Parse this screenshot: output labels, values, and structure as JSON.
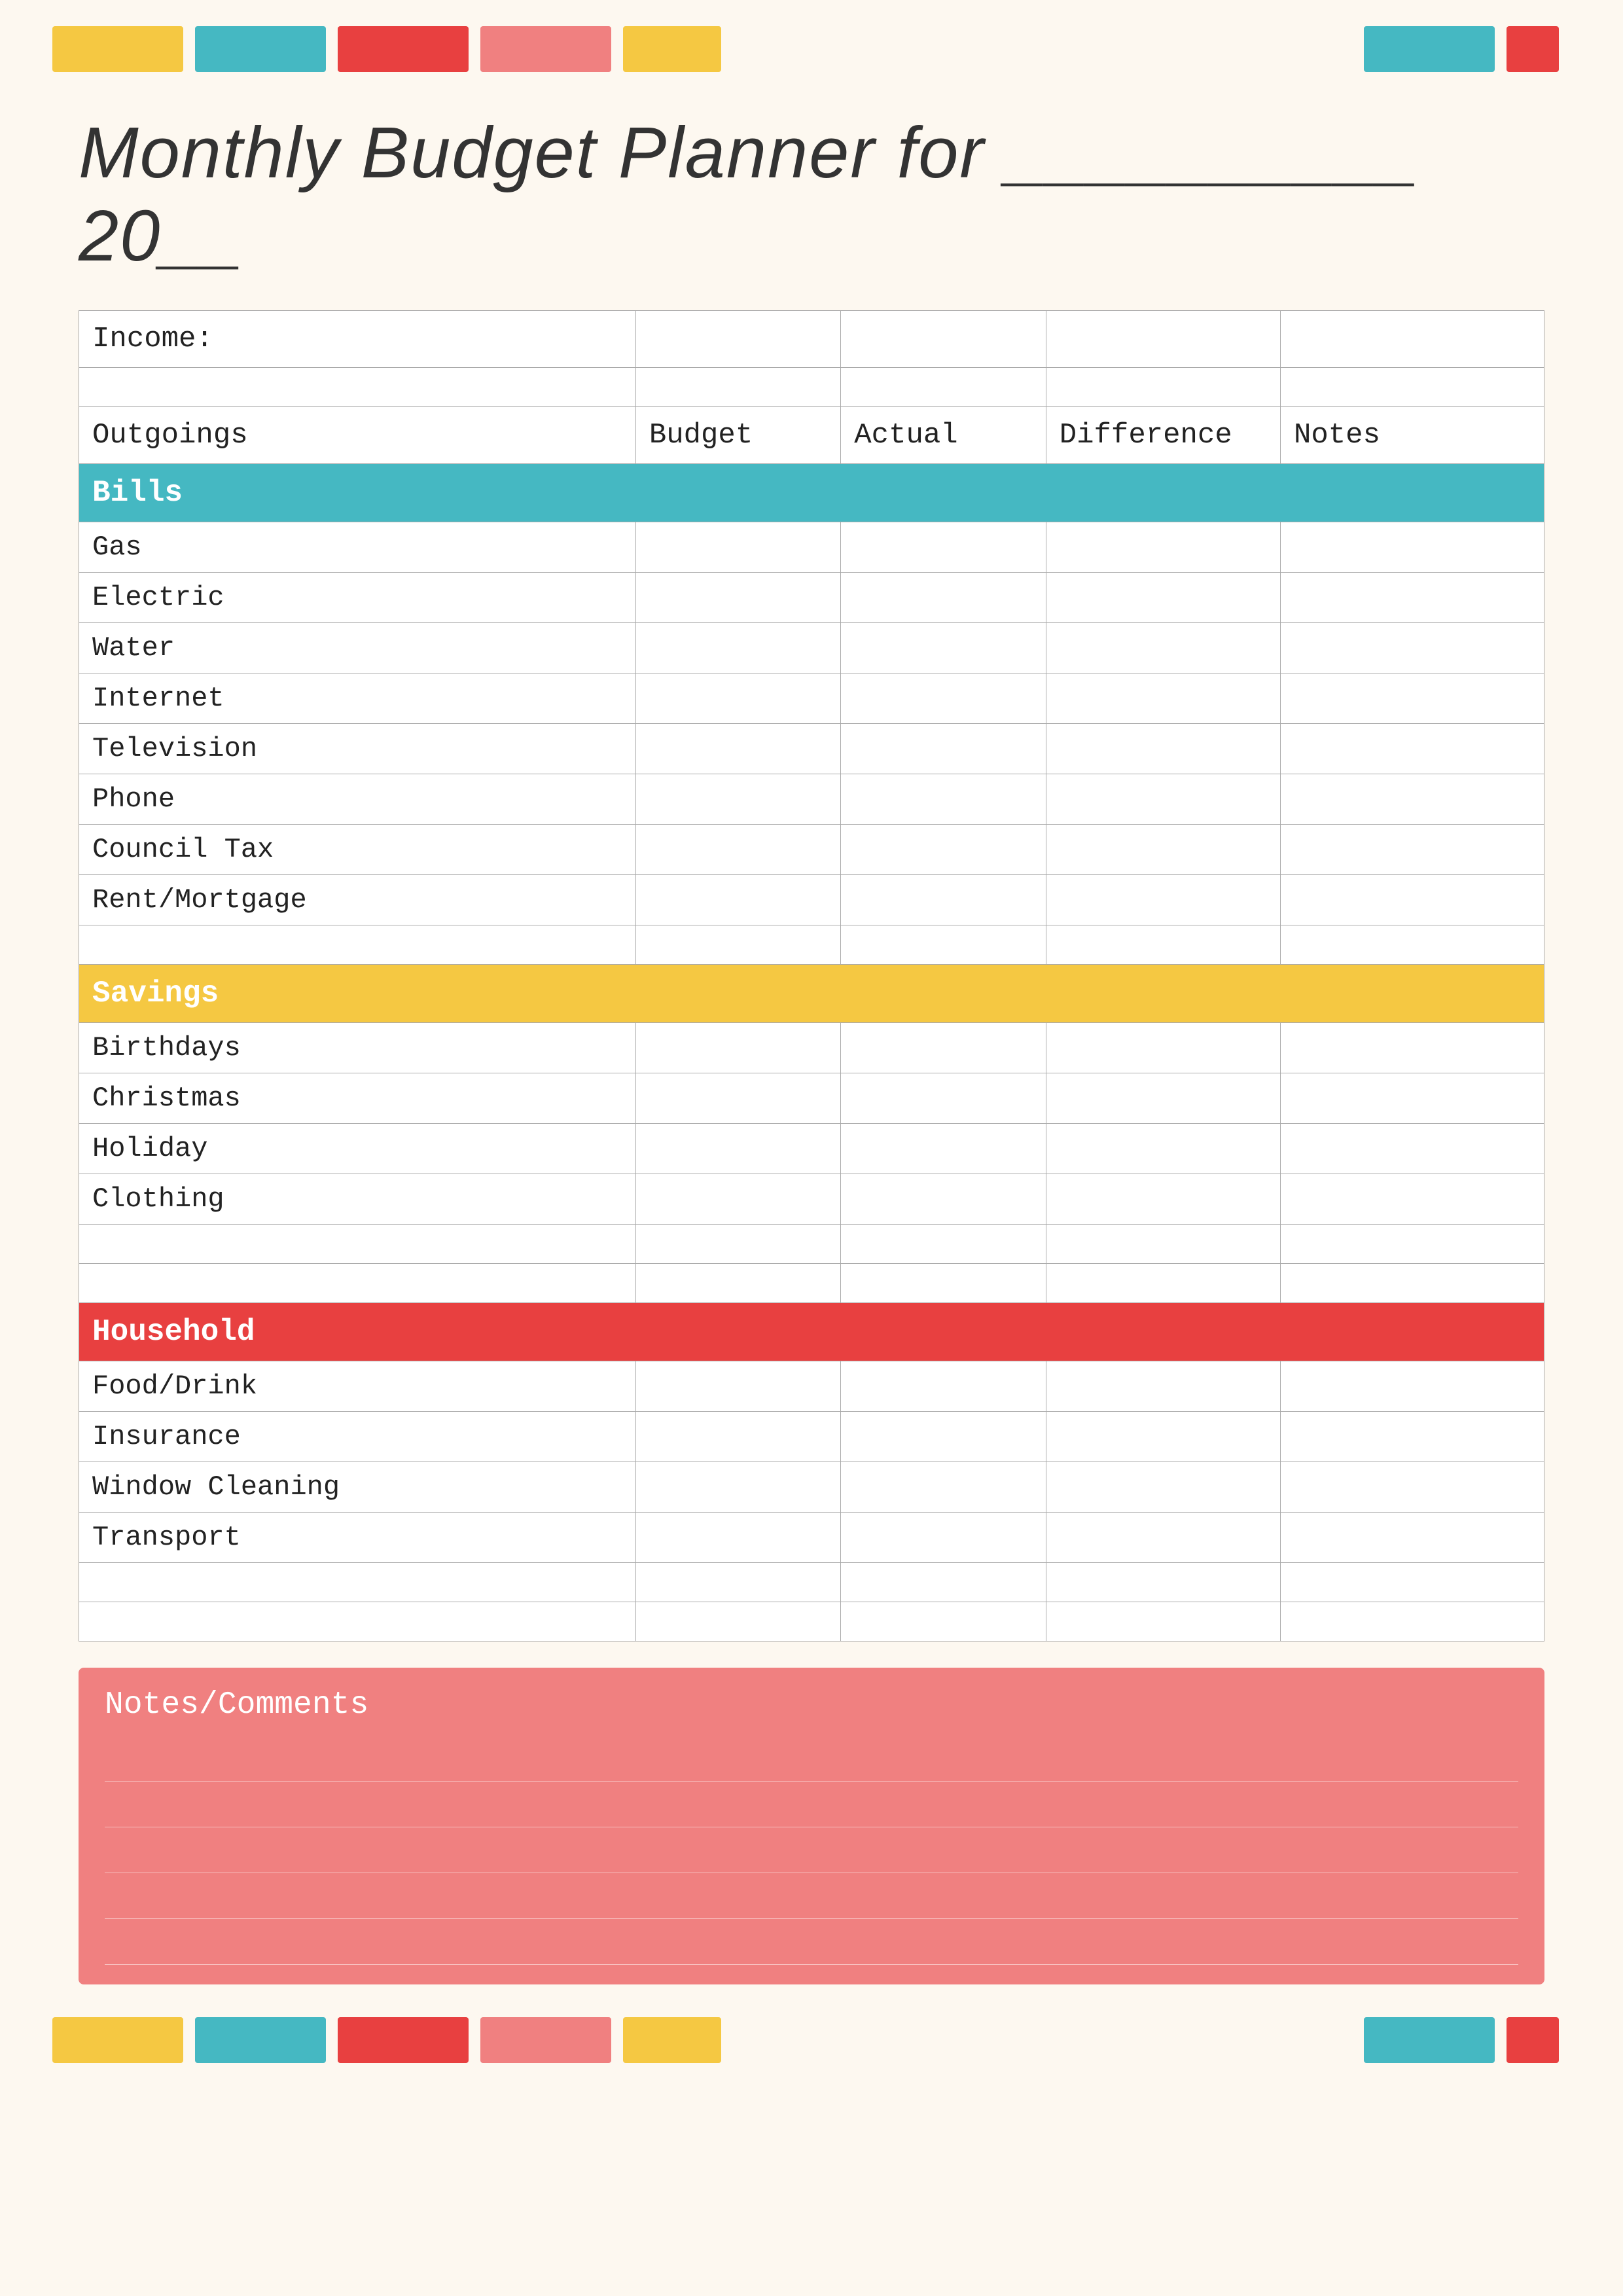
{
  "topBars": [
    {
      "color": "yellow",
      "label": "bar-yellow"
    },
    {
      "color": "teal",
      "label": "bar-teal"
    },
    {
      "color": "red",
      "label": "bar-red"
    },
    {
      "color": "pink",
      "label": "bar-pink"
    },
    {
      "color": "yellow",
      "label": "bar-yellow2"
    },
    {
      "color": "teal",
      "label": "bar-teal2"
    },
    {
      "color": "red",
      "label": "bar-red2"
    }
  ],
  "title": "Monthly Budget Planner for __________ 20__",
  "table": {
    "income_label": "Income:",
    "columns": [
      "Outgoings",
      "Budget",
      "Actual",
      "Difference",
      "Notes"
    ],
    "sections": [
      {
        "name": "Bills",
        "color": "teal",
        "rows": [
          "Gas",
          "Electric",
          "Water",
          "Internet",
          "Television",
          "Phone",
          "Council Tax",
          "Rent/Mortgage"
        ]
      },
      {
        "name": "Savings",
        "color": "yellow",
        "rows": [
          "Birthdays",
          "Christmas",
          "Holiday",
          "Clothing"
        ]
      },
      {
        "name": "Household",
        "color": "red",
        "rows": [
          "Food/Drink",
          "Insurance",
          "Window Cleaning",
          "Transport"
        ]
      }
    ]
  },
  "notes": {
    "title": "Notes/Comments",
    "lines": 5
  },
  "bottomBars": [
    {
      "color": "yellow"
    },
    {
      "color": "teal"
    },
    {
      "color": "red"
    },
    {
      "color": "pink"
    },
    {
      "color": "yellow"
    },
    {
      "color": "teal"
    },
    {
      "color": "red"
    }
  ]
}
